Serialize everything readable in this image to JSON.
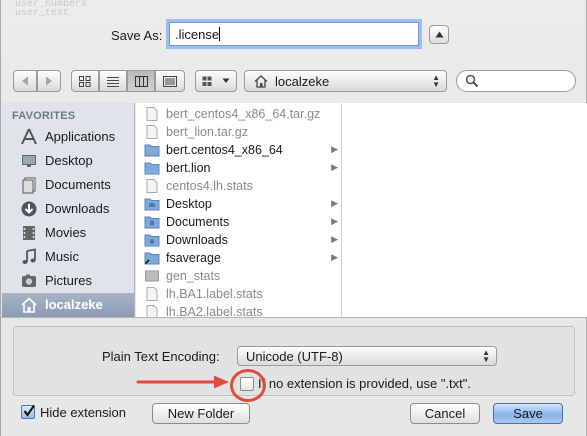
{
  "dialog": {
    "background_text": [
      "user_numbers",
      "user_text"
    ],
    "save_as_label": "Save As:",
    "filename_value": ".license",
    "expand_symbol": "▲"
  },
  "toolbar": {
    "location_label": "localzeke",
    "search_placeholder": ""
  },
  "sidebar": {
    "header": "FAVORITES",
    "items": [
      {
        "label": "Applications",
        "icon": "applications-icon"
      },
      {
        "label": "Desktop",
        "icon": "desktop-icon"
      },
      {
        "label": "Documents",
        "icon": "documents-icon"
      },
      {
        "label": "Downloads",
        "icon": "downloads-icon"
      },
      {
        "label": "Movies",
        "icon": "movies-icon"
      },
      {
        "label": "Music",
        "icon": "music-icon"
      },
      {
        "label": "Pictures",
        "icon": "pictures-icon"
      },
      {
        "label": "localzeke",
        "icon": "home-icon",
        "selected": true
      }
    ]
  },
  "files": [
    {
      "name": "bert_centos4_x86_64.tar.gz",
      "kind": "file",
      "dim": true
    },
    {
      "name": "bert_lion.tar.gz",
      "kind": "file",
      "dim": true
    },
    {
      "name": "bert.centos4_x86_64",
      "kind": "folder",
      "dim": false
    },
    {
      "name": "bert.lion",
      "kind": "folder",
      "dim": false
    },
    {
      "name": "centos4.lh.stats",
      "kind": "file",
      "dim": true
    },
    {
      "name": "Desktop",
      "kind": "folder",
      "dim": false
    },
    {
      "name": "Documents",
      "kind": "folder",
      "dim": false
    },
    {
      "name": "Downloads",
      "kind": "downloads-folder",
      "dim": false
    },
    {
      "name": "fsaverage",
      "kind": "alias-folder",
      "dim": false
    },
    {
      "name": "gen_stats",
      "kind": "exec",
      "dim": true
    },
    {
      "name": "lh.BA1.label.stats",
      "kind": "file",
      "dim": true
    },
    {
      "name": "lh.BA2.label.stats",
      "kind": "file",
      "dim": true
    }
  ],
  "options": {
    "encoding_label": "Plain Text Encoding:",
    "encoding_value": "Unicode (UTF-8)",
    "txt_checkbox_label": "If no extension is provided, use \".txt\".",
    "txt_checked": false,
    "hide_extension_label": "Hide extension",
    "hide_extension_checked": true
  },
  "buttons": {
    "new_folder": "New Folder",
    "cancel": "Cancel",
    "save": "Save"
  },
  "colors": {
    "annotation": "#e24b3b",
    "selection": "#8c9cb4",
    "default_button": "#8ab3ec"
  }
}
